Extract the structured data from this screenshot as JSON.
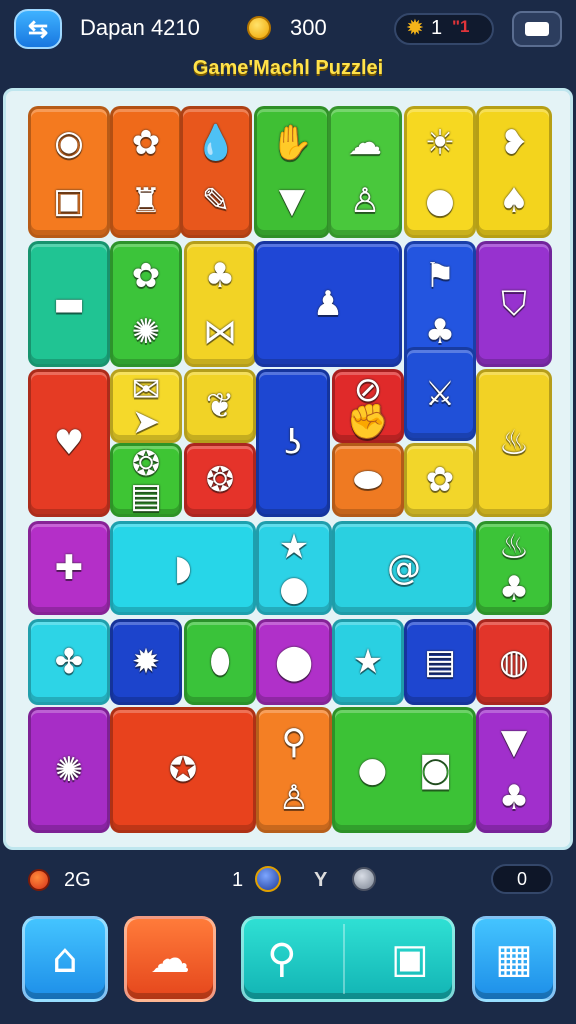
{
  "header": {
    "back_icon": "swap-arrows-icon",
    "player_name": "Dapan 4210",
    "coins": "300",
    "level": "1",
    "level_extra": "\"1",
    "game_title": "Game'Machl Puzzlei"
  },
  "board": {
    "tiles": [
      {
        "name": "tile-eye-camera",
        "color": "#f47a1f",
        "icons": [
          "eye-icon",
          "camera-icon"
        ],
        "glyphs": [
          "◉",
          "▣"
        ]
      },
      {
        "name": "tile-gear-robot",
        "color": "#ef6a1a",
        "icons": [
          "gear-icon",
          "robot-icon"
        ],
        "glyphs": [
          "✿",
          "♜"
        ]
      },
      {
        "name": "tile-drop-brush",
        "color": "#e8571c",
        "icons": [
          "water-drop-icon",
          "brush-icon"
        ],
        "glyphs": [
          "💧",
          "✎"
        ]
      },
      {
        "name": "tile-glove-arrowhead",
        "color": "#3fbf34",
        "icons": [
          "glove-icon",
          "arrowhead-icon"
        ],
        "glyphs": [
          "✋",
          "▼"
        ]
      },
      {
        "name": "tile-cloud-lamp",
        "color": "#49c83c",
        "icons": [
          "cloud-icon",
          "lamp-icon"
        ],
        "glyphs": [
          "☁",
          "♙"
        ]
      },
      {
        "name": "tile-sun-lemon",
        "color": "#f6d821",
        "icons": [
          "sun-icon",
          "lemon-icon"
        ],
        "glyphs": [
          "☀",
          "●"
        ]
      },
      {
        "name": "tile-meat-leaf",
        "color": "#f3d41d",
        "icons": [
          "meat-icon",
          "leaf-icon"
        ],
        "glyphs": [
          "❥",
          "♠"
        ]
      },
      {
        "name": "tile-cake",
        "color": "#20c493",
        "icons": [
          "cake-icon"
        ],
        "glyphs": [
          "▬"
        ]
      },
      {
        "name": "tile-flower-shell",
        "color": "#3cc43a",
        "icons": [
          "flower-icon",
          "shell-icon"
        ],
        "glyphs": [
          "✿",
          "✺"
        ]
      },
      {
        "name": "tile-hat-bow",
        "color": "#f2d325",
        "icons": [
          "hat-icon",
          "bow-icon"
        ],
        "glyphs": [
          "♣",
          "⋈"
        ]
      },
      {
        "name": "tile-bottle",
        "color": "#1f47d6",
        "icons": [
          "bottle-icon"
        ],
        "glyphs": [
          "♟"
        ]
      },
      {
        "name": "tile-flag-plant",
        "color": "#2355e0",
        "icons": [
          "flag-icon",
          "sprout-icon"
        ],
        "glyphs": [
          "⚑",
          "♣"
        ]
      },
      {
        "name": "tile-shield",
        "color": "#9732cf",
        "icons": [
          "shield-icon"
        ],
        "glyphs": [
          "⛉"
        ]
      },
      {
        "name": "tile-heart",
        "color": "#e53b24",
        "icons": [
          "heart-icon"
        ],
        "glyphs": [
          "♥"
        ]
      },
      {
        "name": "tile-bubble-rocket",
        "color": "#f5d92a",
        "icons": [
          "speech-bubble-icon",
          "rocket-icon"
        ],
        "glyphs": [
          "✉",
          "➤"
        ]
      },
      {
        "name": "tile-leaf",
        "color": "#f1d326",
        "icons": [
          "leaf-icon"
        ],
        "glyphs": [
          "❦"
        ]
      },
      {
        "name": "tile-hook",
        "color": "#1d47d2",
        "icons": [
          "hook-icon"
        ],
        "glyphs": [
          "ʖ"
        ]
      },
      {
        "name": "tile-paperclip-hand",
        "color": "#e02a2a",
        "icons": [
          "paperclip-icon",
          "hand-icon"
        ],
        "glyphs": [
          "⊘",
          "✊"
        ]
      },
      {
        "name": "tile-sword",
        "color": "#2050d8",
        "icons": [
          "sword-icon"
        ],
        "glyphs": [
          "⚔"
        ]
      },
      {
        "name": "tile-candle",
        "color": "#f2d225",
        "icons": [
          "candle-icon"
        ],
        "glyphs": [
          "♨"
        ]
      },
      {
        "name": "tile-sun-radio",
        "color": "#3ec534",
        "icons": [
          "sun-icon",
          "radio-icon"
        ],
        "glyphs": [
          "❂",
          "▤"
        ]
      },
      {
        "name": "tile-sunflower",
        "color": "#e5332a",
        "icons": [
          "sunflower-icon"
        ],
        "glyphs": [
          "❂"
        ]
      },
      {
        "name": "tile-pill",
        "color": "#ef7a22",
        "icons": [
          "pill-icon"
        ],
        "glyphs": [
          "⬬"
        ]
      },
      {
        "name": "tile-flower-yellow",
        "color": "#f2d62a",
        "icons": [
          "flower-icon"
        ],
        "glyphs": [
          "✿"
        ]
      },
      {
        "name": "tile-cross",
        "color": "#b42fc8",
        "icons": [
          "cross-icon"
        ],
        "glyphs": [
          "✚"
        ]
      },
      {
        "name": "tile-pickle",
        "color": "#27d6e8",
        "icons": [
          "pickle-icon"
        ],
        "glyphs": [
          "◗"
        ]
      },
      {
        "name": "tile-star-orange",
        "color": "#2cd2e6",
        "icons": [
          "star-icon",
          "orange-icon"
        ],
        "glyphs": [
          "★",
          "●"
        ]
      },
      {
        "name": "tile-snail",
        "color": "#2ad0e0",
        "icons": [
          "snail-icon"
        ],
        "glyphs": [
          "@"
        ]
      },
      {
        "name": "tile-pot-plant",
        "color": "#3cc438",
        "icons": [
          "pot-icon",
          "potted-plant-icon"
        ],
        "glyphs": [
          "♨",
          "♣"
        ]
      },
      {
        "name": "tile-pineapple",
        "color": "#2dd4e6",
        "icons": [
          "pineapple-icon"
        ],
        "glyphs": [
          "✤"
        ]
      },
      {
        "name": "tile-gear-red",
        "color": "#1c44cc",
        "icons": [
          "gear-icon"
        ],
        "glyphs": [
          "✹"
        ]
      },
      {
        "name": "tile-potato",
        "color": "#3ac33a",
        "icons": [
          "potato-icon"
        ],
        "glyphs": [
          "⬮"
        ]
      },
      {
        "name": "tile-bulb",
        "color": "#b030c9",
        "icons": [
          "lightbulb-icon"
        ],
        "glyphs": [
          "⬤"
        ]
      },
      {
        "name": "tile-star-red",
        "color": "#2ad0e2",
        "icons": [
          "star-icon"
        ],
        "glyphs": [
          "★"
        ]
      },
      {
        "name": "tile-notepad",
        "color": "#1e46d0",
        "icons": [
          "notepad-icon"
        ],
        "glyphs": [
          "▤"
        ]
      },
      {
        "name": "tile-grenade",
        "color": "#e2352a",
        "icons": [
          "grenade-icon"
        ],
        "glyphs": [
          "◍"
        ]
      },
      {
        "name": "tile-gear-green",
        "color": "#a72dc6",
        "icons": [
          "gear-icon"
        ],
        "glyphs": [
          "✺"
        ]
      },
      {
        "name": "tile-sun-badge",
        "color": "#e8421d",
        "icons": [
          "sun-badge-icon"
        ],
        "glyphs": [
          "✪"
        ]
      },
      {
        "name": "tile-rocket-candle",
        "color": "#f47f24",
        "icons": [
          "rocket-icon",
          "candle-icon"
        ],
        "glyphs": [
          "⚲",
          "♙"
        ]
      },
      {
        "name": "tile-fruit-money",
        "color": "#3cc236",
        "icons": [
          "fruit-icon",
          "money-icon"
        ],
        "glyphs": [
          "●",
          "◙"
        ]
      },
      {
        "name": "tile-carrot-plant",
        "color": "#a12fcc",
        "icons": [
          "carrot-icon",
          "potted-plant-icon"
        ],
        "glyphs": [
          "▼",
          "♣"
        ]
      },
      {
        "name": "tile-apple",
        "color": "#f0641c",
        "icons": [
          "apple-icon"
        ],
        "glyphs": [
          "●"
        ]
      }
    ]
  },
  "status": {
    "moves_icon": "apple-icon",
    "moves": "2G",
    "hints": "1",
    "bomb_icon": "bomb-icon",
    "shuffle_label": "Y",
    "stone_icon": "stone-icon",
    "score": "0"
  },
  "actions": [
    {
      "name": "home-button",
      "icon": "home-icon",
      "glyph": "⌂"
    },
    {
      "name": "cloud-button",
      "icon": "cloud-icon",
      "glyph": "☁"
    },
    {
      "name": "search-button",
      "icon": "magnifier-icon",
      "glyph": "⚲"
    },
    {
      "name": "camera-button",
      "icon": "camera-icon",
      "glyph": "▣"
    },
    {
      "name": "grid-button",
      "icon": "grid-icon",
      "glyph": "▦"
    }
  ]
}
